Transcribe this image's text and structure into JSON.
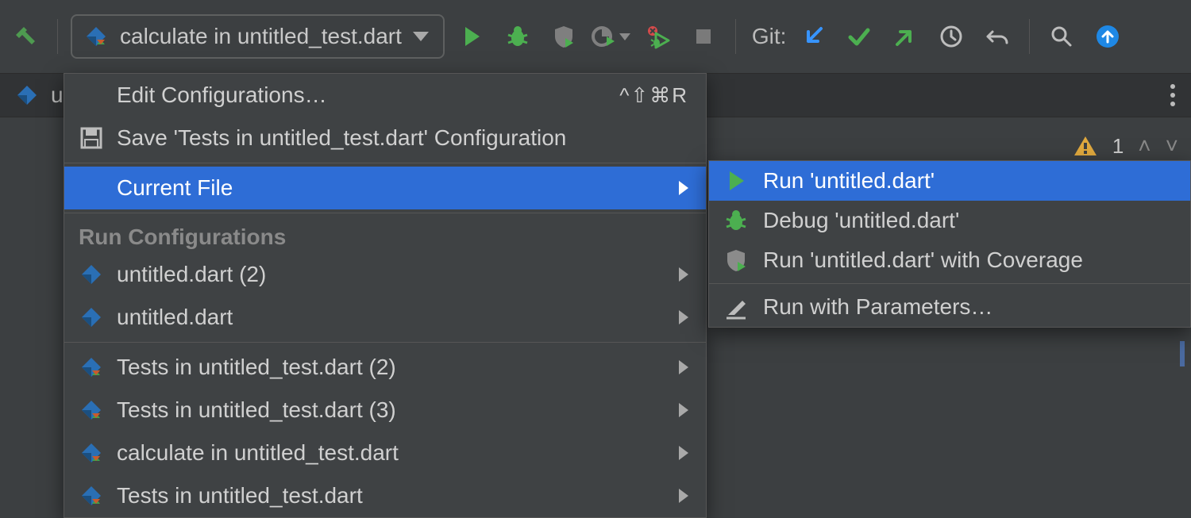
{
  "toolbar": {
    "run_config_label": "calculate in untitled_test.dart",
    "git_label": "Git:"
  },
  "tabstrip": {
    "visible_tab_fragment": "u"
  },
  "badges": {
    "inspection_count": "1"
  },
  "popup": {
    "edit_config": "Edit Configurations…",
    "edit_shortcut": "^⇧⌘R",
    "save_config": "Save 'Tests in untitled_test.dart' Configuration",
    "current_file": "Current File",
    "section_header": "Run Configurations",
    "items": [
      {
        "label": "untitled.dart (2)",
        "icon": "dart"
      },
      {
        "label": "untitled.dart",
        "icon": "dart"
      }
    ],
    "test_items": [
      {
        "label": "Tests in untitled_test.dart (2)"
      },
      {
        "label": "Tests in untitled_test.dart (3)"
      },
      {
        "label": "calculate in untitled_test.dart"
      },
      {
        "label": "Tests in untitled_test.dart"
      }
    ]
  },
  "submenu": {
    "run": "Run 'untitled.dart'",
    "debug": "Debug 'untitled.dart'",
    "coverage": "Run 'untitled.dart' with Coverage",
    "params": "Run with Parameters…"
  }
}
